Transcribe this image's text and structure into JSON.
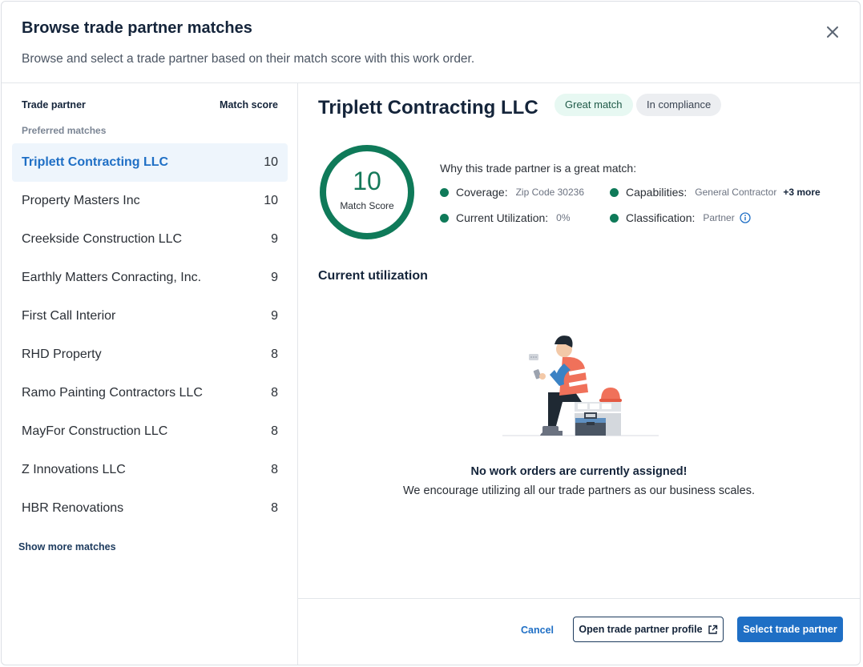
{
  "header": {
    "title": "Browse trade partner matches",
    "subtitle": "Browse and select a trade partner based on their match score with this work order."
  },
  "list": {
    "col_partner": "Trade partner",
    "col_score": "Match score",
    "section_label": "Preferred matches",
    "items": [
      {
        "name": "Triplett Contracting LLC",
        "score": "10"
      },
      {
        "name": "Property Masters Inc",
        "score": "10"
      },
      {
        "name": "Creekside Construction LLC",
        "score": "9"
      },
      {
        "name": "Earthly Matters Conracting, Inc.",
        "score": "9"
      },
      {
        "name": "First Call Interior",
        "score": "9"
      },
      {
        "name": "RHD Property",
        "score": "8"
      },
      {
        "name": "Ramo Painting Contractors LLC",
        "score": "8"
      },
      {
        "name": "MayFor Construction LLC",
        "score": "8"
      },
      {
        "name": "Z Innovations LLC",
        "score": "8"
      },
      {
        "name": "HBR Renovations",
        "score": "8"
      }
    ],
    "show_more": "Show more matches"
  },
  "detail": {
    "name": "Triplett Contracting LLC",
    "badge_match": "Great match",
    "badge_compliance": "In compliance",
    "score": "10",
    "score_label": "Match Score",
    "why_title": "Why this trade partner is a great match:",
    "criteria": {
      "coverage_label": "Coverage:",
      "coverage_value": "Zip Code 30236",
      "capabilities_label": "Capabilities:",
      "capabilities_value": "General Contractor",
      "capabilities_more": "+3 more",
      "utilization_label": "Current Utilization:",
      "utilization_value": "0%",
      "classification_label": "Classification:",
      "classification_value": "Partner"
    },
    "utilization_heading": "Current utilization",
    "empty_title": "No work orders are currently assigned!",
    "empty_subtitle": "We encourage utilizing all our trade partners as our business scales."
  },
  "footer": {
    "cancel": "Cancel",
    "open_profile": "Open trade partner profile",
    "select": "Select trade partner"
  },
  "colors": {
    "accent": "#1f6fc5",
    "match_green": "#0f7a59",
    "dark_text": "#14243a"
  }
}
